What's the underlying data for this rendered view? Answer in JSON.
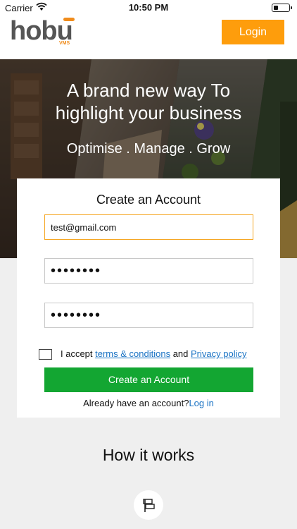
{
  "status_bar": {
    "carrier": "Carrier",
    "time": "10:50 PM",
    "battery_level": 0.3
  },
  "header": {
    "logo_text": "hobu",
    "logo_sub": "VMS",
    "login_label": "Login"
  },
  "hero": {
    "title_line1": "A brand new way To",
    "title_line2": "highlight your business",
    "tagline": "Optimise . Manage . Grow"
  },
  "form": {
    "title": "Create an Account",
    "email_value": "test@gmail.com",
    "password_value": "••••••••",
    "confirm_password_value": "••••••••",
    "accept_prefix": "I accept ",
    "terms_link": "terms & conditions",
    "and_text": " and ",
    "privacy_link": "Privacy policy",
    "submit_label": "Create an Account",
    "signin_prompt": "Already have an account?",
    "signin_link": "Log in"
  },
  "how_it_works": {
    "title": "How it works",
    "icon": "signpost-icon"
  },
  "colors": {
    "accent": "#fe9d0c",
    "success": "#13a632",
    "link": "#1a73c4"
  }
}
